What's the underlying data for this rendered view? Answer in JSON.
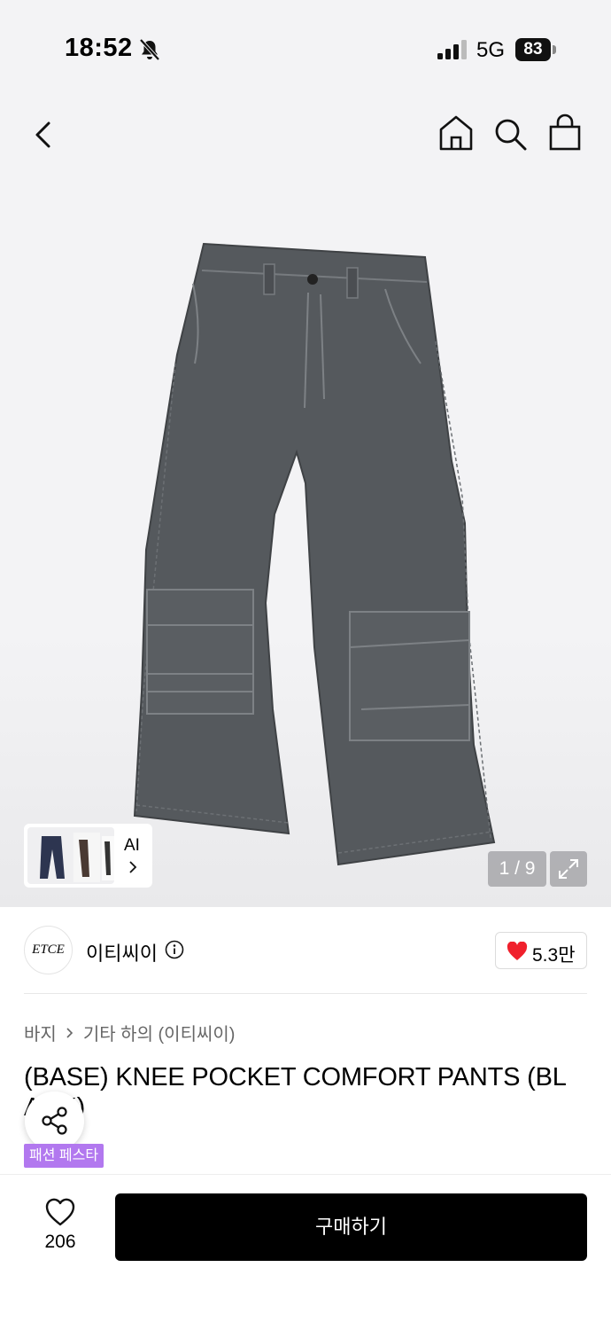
{
  "status_bar": {
    "time": "18:52",
    "network": "5G",
    "battery": "83"
  },
  "gallery": {
    "page_indicator": "1 / 9",
    "ai_label": "AI"
  },
  "brand": {
    "logo_text": "ETCE",
    "name": "이티씨이",
    "like_count": "5.3만"
  },
  "product": {
    "breadcrumb": [
      "바지",
      "기타 하의 (이티씨이)"
    ],
    "title_line1": "(BASE) KNEE POCKET COMFORT PANTS (BL",
    "title_line2": "ACK)",
    "promo_badge": "패션 페스타"
  },
  "bottom_bar": {
    "wish_count": "206",
    "buy_label": "구매하기"
  },
  "colors": {
    "accent_purple": "#b278ef",
    "heart_red": "#f0202c",
    "pants_gray": "#55595d"
  }
}
